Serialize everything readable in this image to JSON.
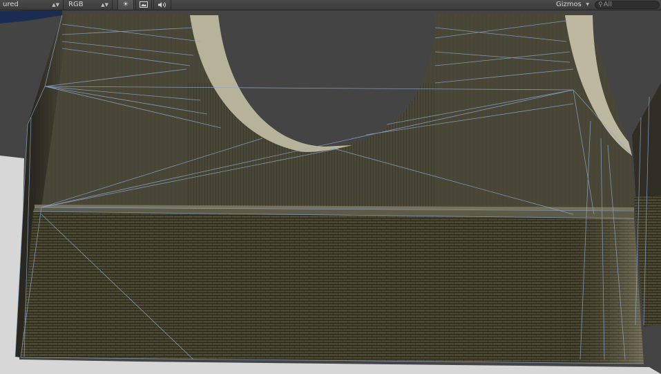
{
  "toolbar": {
    "draw_mode": "ured",
    "color_mode": "RGB",
    "gizmos_label": "Gizmos",
    "search_placeholder": "All",
    "icons": {
      "sun": "sun-icon",
      "image": "image-icon",
      "audio": "speaker-icon",
      "dropdown": "chevron-down-icon",
      "search": "search-icon"
    }
  },
  "colors": {
    "sky": "#444444",
    "ground": "#d6d6d6",
    "wall_upper": "#4a473a",
    "wall_lower": "#3a372a",
    "arch_band": "#b8b49a",
    "wireframe": "#8ea6cc"
  }
}
